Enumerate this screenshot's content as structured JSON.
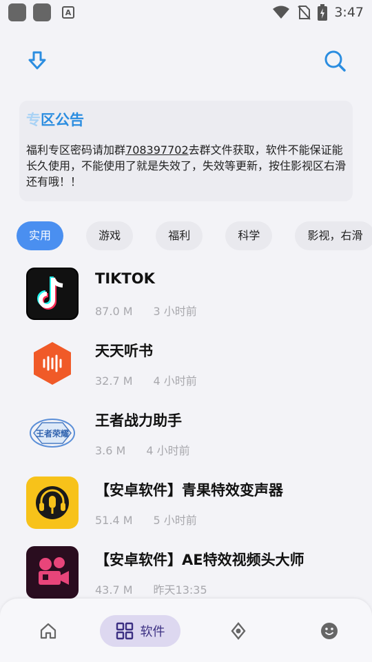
{
  "status_bar": {
    "time": "3:47",
    "icon_letter": "A"
  },
  "notice": {
    "title_faded": "专",
    "title_main": "区公告",
    "text_before": "福利专区密码请加群",
    "text_link": "708397702",
    "text_after": "去群文件获取，软件不能保证能长久使用，不能使用了就是失效了，失效等更新，按住影视区右滑还有哦！！"
  },
  "tabs": [
    "实用",
    "游戏",
    "福利",
    "科学",
    "影视，右滑"
  ],
  "apps": [
    {
      "name": "TIKTOK",
      "size": "87.0 M",
      "time": "3 小时前",
      "icon": "tiktok-icon"
    },
    {
      "name": "天天听书",
      "size": "32.7 M",
      "time": "4 小时前",
      "icon": "audiobook-icon"
    },
    {
      "name": "王者战力助手",
      "size": "3.6 M",
      "time": "4 小时前",
      "icon": "game-logo-icon",
      "icon_text": "王者荣耀"
    },
    {
      "name": "【安卓软件】青果特效变声器",
      "size": "51.4 M",
      "time": "5 小时前",
      "icon": "microphone-icon"
    },
    {
      "name": "【安卓软件】AE特效视频头大师",
      "size": "43.7 M",
      "time": "昨天13:35",
      "icon": "film-camera-icon"
    }
  ],
  "bottom_nav": {
    "active_label": "软件"
  },
  "colors": {
    "accent": "#2b8de0",
    "chip_active": "#4a8ff0",
    "nav_active_bg": "#ddd8f0"
  }
}
